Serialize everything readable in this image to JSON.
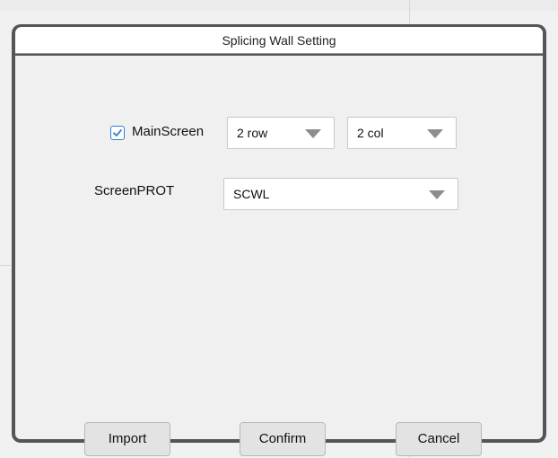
{
  "dialog": {
    "title": "Splicing Wall Setting"
  },
  "main_screen": {
    "label": "MainScreen",
    "checked": true,
    "rows_value": "2 row",
    "cols_value": "2 col"
  },
  "screen_prot": {
    "label": "ScreenPROT",
    "value": "SCWL"
  },
  "buttons": {
    "import_label": "Import",
    "confirm_label": "Confirm",
    "cancel_label": "Cancel"
  },
  "colors": {
    "frame": "#555555",
    "checkbox_accent": "#2f7fd8",
    "dropdown_arrow": "#8d8d8d"
  },
  "icons": {
    "checkbox": "check-icon",
    "dropdown": "triangle-down-icon"
  }
}
